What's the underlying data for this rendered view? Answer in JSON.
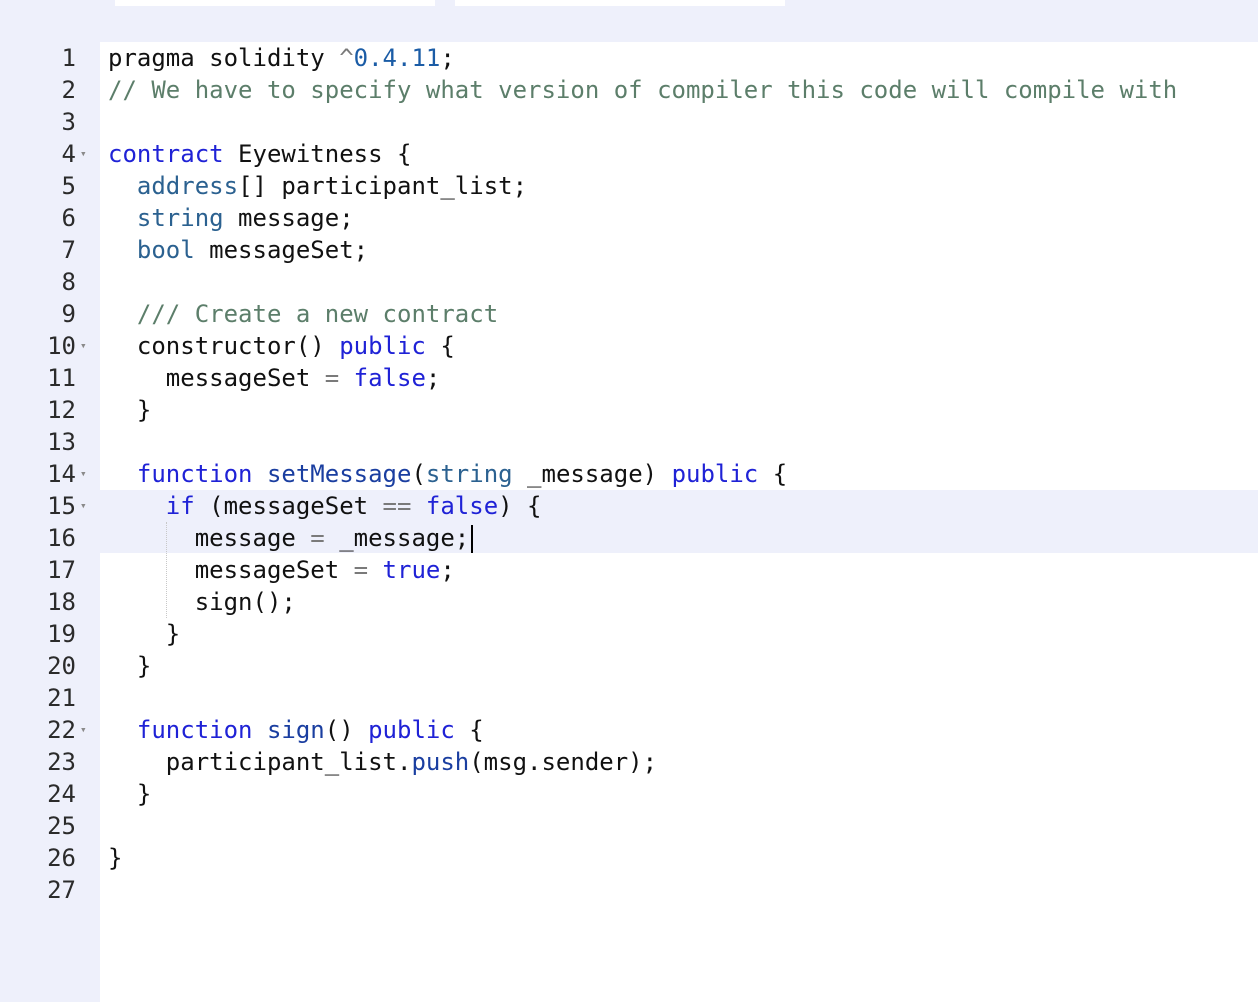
{
  "editor": {
    "lines": [
      {
        "num": "1",
        "fold": false,
        "tokens": [
          {
            "t": "pragma solidity ",
            "c": ""
          },
          {
            "t": "^",
            "c": "op"
          },
          {
            "t": "0.4.11",
            "c": "num"
          },
          {
            "t": ";",
            "c": ""
          }
        ]
      },
      {
        "num": "2",
        "fold": false,
        "tokens": [
          {
            "t": "// We have to specify what version of compiler this code will compile with",
            "c": "cm"
          }
        ]
      },
      {
        "num": "3",
        "fold": false,
        "tokens": []
      },
      {
        "num": "4",
        "fold": true,
        "tokens": [
          {
            "t": "contract",
            "c": "kw"
          },
          {
            "t": " Eyewitness {",
            "c": ""
          }
        ]
      },
      {
        "num": "5",
        "fold": false,
        "tokens": [
          {
            "t": "  ",
            "c": ""
          },
          {
            "t": "address",
            "c": "ty"
          },
          {
            "t": "[] participant_list;",
            "c": ""
          }
        ]
      },
      {
        "num": "6",
        "fold": false,
        "tokens": [
          {
            "t": "  ",
            "c": ""
          },
          {
            "t": "string",
            "c": "ty"
          },
          {
            "t": " message;",
            "c": ""
          }
        ]
      },
      {
        "num": "7",
        "fold": false,
        "tokens": [
          {
            "t": "  ",
            "c": ""
          },
          {
            "t": "bool",
            "c": "ty"
          },
          {
            "t": " messageSet;",
            "c": ""
          }
        ]
      },
      {
        "num": "8",
        "fold": false,
        "tokens": []
      },
      {
        "num": "9",
        "fold": false,
        "tokens": [
          {
            "t": "  ",
            "c": ""
          },
          {
            "t": "/// Create a new contract",
            "c": "cm"
          }
        ]
      },
      {
        "num": "10",
        "fold": true,
        "tokens": [
          {
            "t": "  constructor() ",
            "c": ""
          },
          {
            "t": "public",
            "c": "kw"
          },
          {
            "t": " {",
            "c": ""
          }
        ]
      },
      {
        "num": "11",
        "fold": false,
        "tokens": [
          {
            "t": "    messageSet ",
            "c": ""
          },
          {
            "t": "=",
            "c": "op"
          },
          {
            "t": " ",
            "c": ""
          },
          {
            "t": "false",
            "c": "kw"
          },
          {
            "t": ";",
            "c": ""
          }
        ]
      },
      {
        "num": "12",
        "fold": false,
        "tokens": [
          {
            "t": "  }",
            "c": ""
          }
        ]
      },
      {
        "num": "13",
        "fold": false,
        "tokens": []
      },
      {
        "num": "14",
        "fold": true,
        "tokens": [
          {
            "t": "  ",
            "c": ""
          },
          {
            "t": "function",
            "c": "kw"
          },
          {
            "t": " ",
            "c": ""
          },
          {
            "t": "setMessage",
            "c": "fn"
          },
          {
            "t": "(",
            "c": ""
          },
          {
            "t": "string",
            "c": "ty"
          },
          {
            "t": " _message) ",
            "c": ""
          },
          {
            "t": "public",
            "c": "kw"
          },
          {
            "t": " {",
            "c": ""
          }
        ]
      },
      {
        "num": "15",
        "fold": true,
        "tokens": [
          {
            "t": "    ",
            "c": ""
          },
          {
            "t": "if",
            "c": "kw"
          },
          {
            "t": " (messageSet ",
            "c": ""
          },
          {
            "t": "==",
            "c": "op"
          },
          {
            "t": " ",
            "c": ""
          },
          {
            "t": "false",
            "c": "kw"
          },
          {
            "t": ") {",
            "c": ""
          }
        ]
      },
      {
        "num": "16",
        "fold": false,
        "cursor": true,
        "tokens": [
          {
            "t": "      message ",
            "c": ""
          },
          {
            "t": "=",
            "c": "op"
          },
          {
            "t": " _message;",
            "c": ""
          }
        ]
      },
      {
        "num": "17",
        "fold": false,
        "tokens": [
          {
            "t": "      messageSet ",
            "c": ""
          },
          {
            "t": "=",
            "c": "op"
          },
          {
            "t": " ",
            "c": ""
          },
          {
            "t": "true",
            "c": "kw"
          },
          {
            "t": ";",
            "c": ""
          }
        ]
      },
      {
        "num": "18",
        "fold": false,
        "tokens": [
          {
            "t": "      sign();",
            "c": ""
          }
        ]
      },
      {
        "num": "19",
        "fold": false,
        "tokens": [
          {
            "t": "    }",
            "c": ""
          }
        ]
      },
      {
        "num": "20",
        "fold": false,
        "tokens": [
          {
            "t": "  }",
            "c": ""
          }
        ]
      },
      {
        "num": "21",
        "fold": false,
        "tokens": []
      },
      {
        "num": "22",
        "fold": true,
        "tokens": [
          {
            "t": "  ",
            "c": ""
          },
          {
            "t": "function",
            "c": "kw"
          },
          {
            "t": " ",
            "c": ""
          },
          {
            "t": "sign",
            "c": "fn"
          },
          {
            "t": "() ",
            "c": ""
          },
          {
            "t": "public",
            "c": "kw"
          },
          {
            "t": " {",
            "c": ""
          }
        ]
      },
      {
        "num": "23",
        "fold": false,
        "tokens": [
          {
            "t": "    participant_list.",
            "c": ""
          },
          {
            "t": "push",
            "c": "fn"
          },
          {
            "t": "(msg.sender);",
            "c": ""
          }
        ]
      },
      {
        "num": "24",
        "fold": false,
        "tokens": [
          {
            "t": "  }",
            "c": ""
          }
        ]
      },
      {
        "num": "25",
        "fold": false,
        "tokens": []
      },
      {
        "num": "26",
        "fold": false,
        "tokens": [
          {
            "t": "}",
            "c": ""
          }
        ]
      },
      {
        "num": "27",
        "fold": false,
        "tokens": []
      }
    ],
    "colors": {
      "keyword": "#1f22d6",
      "type": "#2b6190",
      "comment": "#5c7e6a",
      "gutter_bg": "#eef0fb",
      "active_line_bg": "#eef0fb"
    },
    "fold_icon": "chevron-down-icon"
  }
}
